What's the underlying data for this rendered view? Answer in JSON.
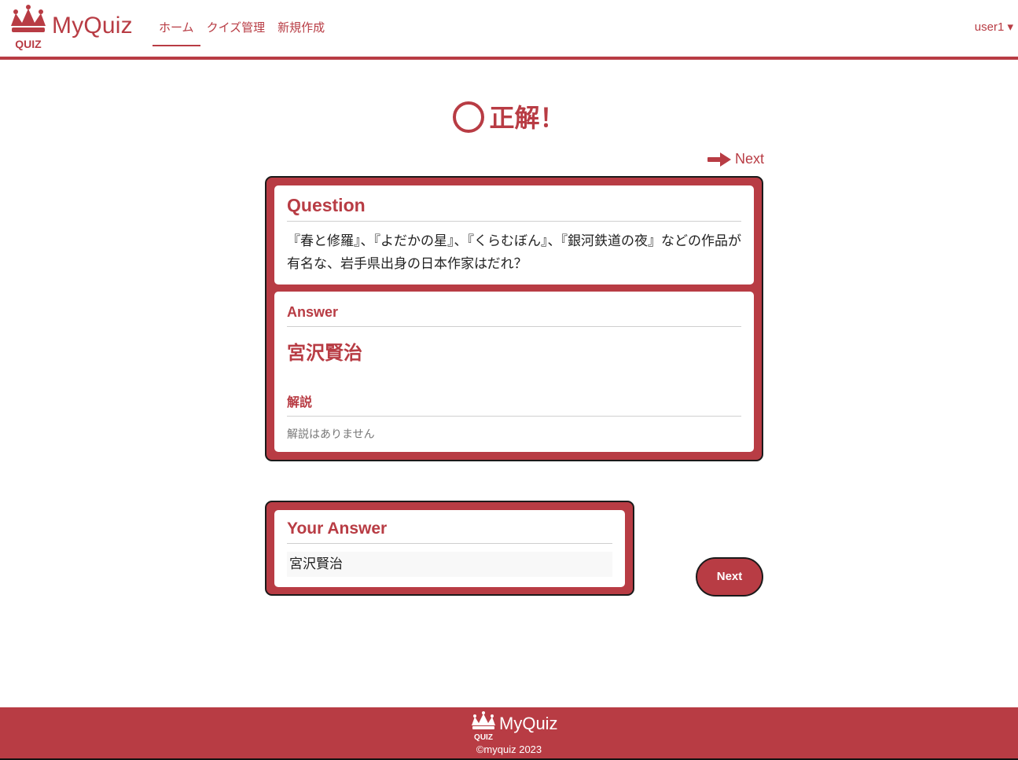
{
  "header": {
    "brand": "MyQuiz",
    "logo_text": "QUIZ",
    "nav": [
      "ホーム",
      "クイズ管理",
      "新規作成"
    ],
    "user": "user1 ▾"
  },
  "result": {
    "label": "正解！"
  },
  "next_link": "Next",
  "question": {
    "title": "Question",
    "text": "『春と修羅』、『よだかの星』、『くらむぼん』、『銀河鉄道の夜』などの作品が有名な、岩手県出身の日本作家はだれ？"
  },
  "answer": {
    "title": "Answer",
    "text": "宮沢賢治",
    "explanation_title": "解説",
    "explanation_text": "解説はありません"
  },
  "your_answer": {
    "title": "Your Answer",
    "value": "宮沢賢治"
  },
  "next_button": "Next",
  "footer": {
    "brand": "MyQuiz",
    "logo_text": "QUIZ",
    "copyright": "©myquiz 2023"
  },
  "colors": {
    "accent": "#b83c44",
    "border": "#1a1a1a"
  }
}
